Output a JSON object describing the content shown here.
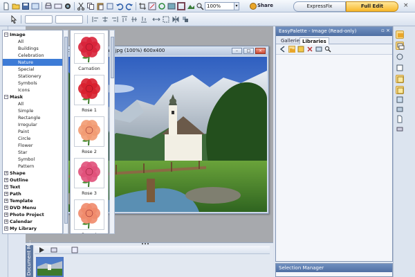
{
  "toolbar": {
    "zoom_value": "100%",
    "share_label": "Share",
    "mode_expressfix": "ExpressFix",
    "mode_fulledit": "Full Edit"
  },
  "image_window": {
    "title": "PhotoImpact X3 Image Library.jpg (100%) 600x400",
    "minimize": "–",
    "maximize": "□",
    "close": "×"
  },
  "document_manager": {
    "label": "Document M..."
  },
  "palette": {
    "title": "EasyPalette - Image (Read-only)",
    "tabs": [
      "Galleries",
      "Libraries"
    ],
    "tree": [
      {
        "type": "cat",
        "label": "Image",
        "sign": "−"
      },
      {
        "type": "sub",
        "label": "All"
      },
      {
        "type": "sub",
        "label": "Buildings"
      },
      {
        "type": "sub",
        "label": "Celebration"
      },
      {
        "type": "sub",
        "label": "Nature",
        "selected": true
      },
      {
        "type": "sub",
        "label": "Special"
      },
      {
        "type": "sub",
        "label": "Stationery"
      },
      {
        "type": "sub",
        "label": "Symbols"
      },
      {
        "type": "sub",
        "label": "Icons"
      },
      {
        "type": "cat",
        "label": "Mask",
        "sign": "−"
      },
      {
        "type": "sub",
        "label": "All"
      },
      {
        "type": "sub",
        "label": "Simple"
      },
      {
        "type": "sub",
        "label": "Rectangle"
      },
      {
        "type": "sub",
        "label": "Irregular"
      },
      {
        "type": "sub",
        "label": "Paint"
      },
      {
        "type": "sub",
        "label": "Circle"
      },
      {
        "type": "sub",
        "label": "Flower"
      },
      {
        "type": "sub",
        "label": "Star"
      },
      {
        "type": "sub",
        "label": "Symbol"
      },
      {
        "type": "sub",
        "label": "Pattern"
      },
      {
        "type": "cat",
        "label": "Shape",
        "sign": "+"
      },
      {
        "type": "cat",
        "label": "Outline",
        "sign": "+"
      },
      {
        "type": "cat",
        "label": "Text",
        "sign": "+"
      },
      {
        "type": "cat",
        "label": "Path",
        "sign": "+"
      },
      {
        "type": "cat",
        "label": "Template",
        "sign": "+"
      },
      {
        "type": "cat",
        "label": "DVD Menu",
        "sign": "+"
      },
      {
        "type": "cat",
        "label": "Photo Project",
        "sign": "+"
      },
      {
        "type": "cat",
        "label": "Calendar",
        "sign": "+"
      },
      {
        "type": "cat",
        "label": "My Library",
        "sign": "+"
      }
    ],
    "thumbnails": [
      {
        "label": "Carnation",
        "color": "#d8223a"
      },
      {
        "label": "Rose 1",
        "color": "#d81f2e"
      },
      {
        "label": "Rose 2",
        "color": "#f29b72"
      },
      {
        "label": "Rose 3",
        "color": "#e0507a"
      },
      {
        "label": "Rose 4",
        "color": "#f08a6a"
      }
    ]
  },
  "selection_manager": {
    "title": "Selection Manager"
  }
}
